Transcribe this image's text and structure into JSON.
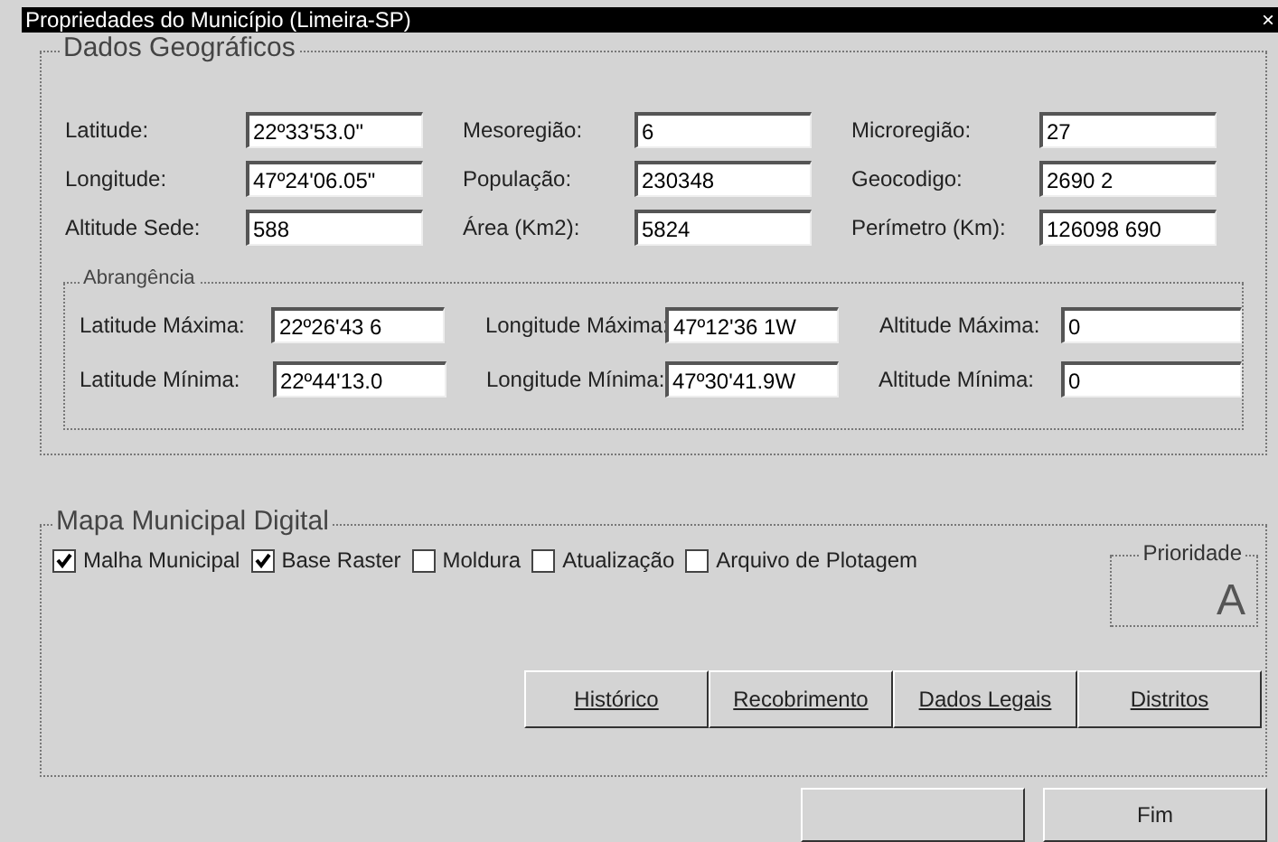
{
  "window": {
    "title": "Propriedades do Município (Limeira-SP)",
    "close": "×"
  },
  "geo": {
    "title": "Dados Geográficos",
    "rows": [
      [
        {
          "label": "Latitude:",
          "value": "22º33'53.0\""
        },
        {
          "label": "Mesoregião:",
          "value": "6"
        },
        {
          "label": "Microregião:",
          "value": "27"
        }
      ],
      [
        {
          "label": "Longitude:",
          "value": "47º24'06.05\""
        },
        {
          "label": "População:",
          "value": "230348"
        },
        {
          "label": "Geocodigo:",
          "value": "2690 2"
        }
      ],
      [
        {
          "label": "Altitude Sede:",
          "value": "588"
        },
        {
          "label": "Área (Km2):",
          "value": "5824"
        },
        {
          "label": "Perímetro (Km):",
          "value": "126098 690"
        }
      ]
    ]
  },
  "coverage": {
    "title": "Abrangência",
    "rows": [
      [
        {
          "label": "Latitude Máxima:",
          "value": "22º26'43 6"
        },
        {
          "label": "Longitude Máxima:",
          "value": "47º12'36 1W"
        },
        {
          "label": "Altitude Máxima:",
          "value": "0"
        }
      ],
      [
        {
          "label": "Latitude Mínima:",
          "value": "22º44'13.0"
        },
        {
          "label": "Longitude Mínima:",
          "value": "47º30'41.9W"
        },
        {
          "label": "Altitude Mínima:",
          "value": "0"
        }
      ]
    ]
  },
  "map": {
    "title": "Mapa Municipal Digital",
    "checkboxes": [
      {
        "label": "Malha Municipal",
        "checked": true
      },
      {
        "label": "Base Raster",
        "checked": true
      },
      {
        "label": "Moldura",
        "checked": false
      },
      {
        "label": "Atualização",
        "checked": false
      },
      {
        "label": "Arquivo de Plotagem",
        "checked": false
      }
    ],
    "priority": {
      "title": "Prioridade",
      "value": "A"
    },
    "buttons": [
      "Histórico",
      "Recobrimento",
      "Dados Legais",
      "Distritos"
    ]
  },
  "footer_buttons": [
    "Fim"
  ]
}
